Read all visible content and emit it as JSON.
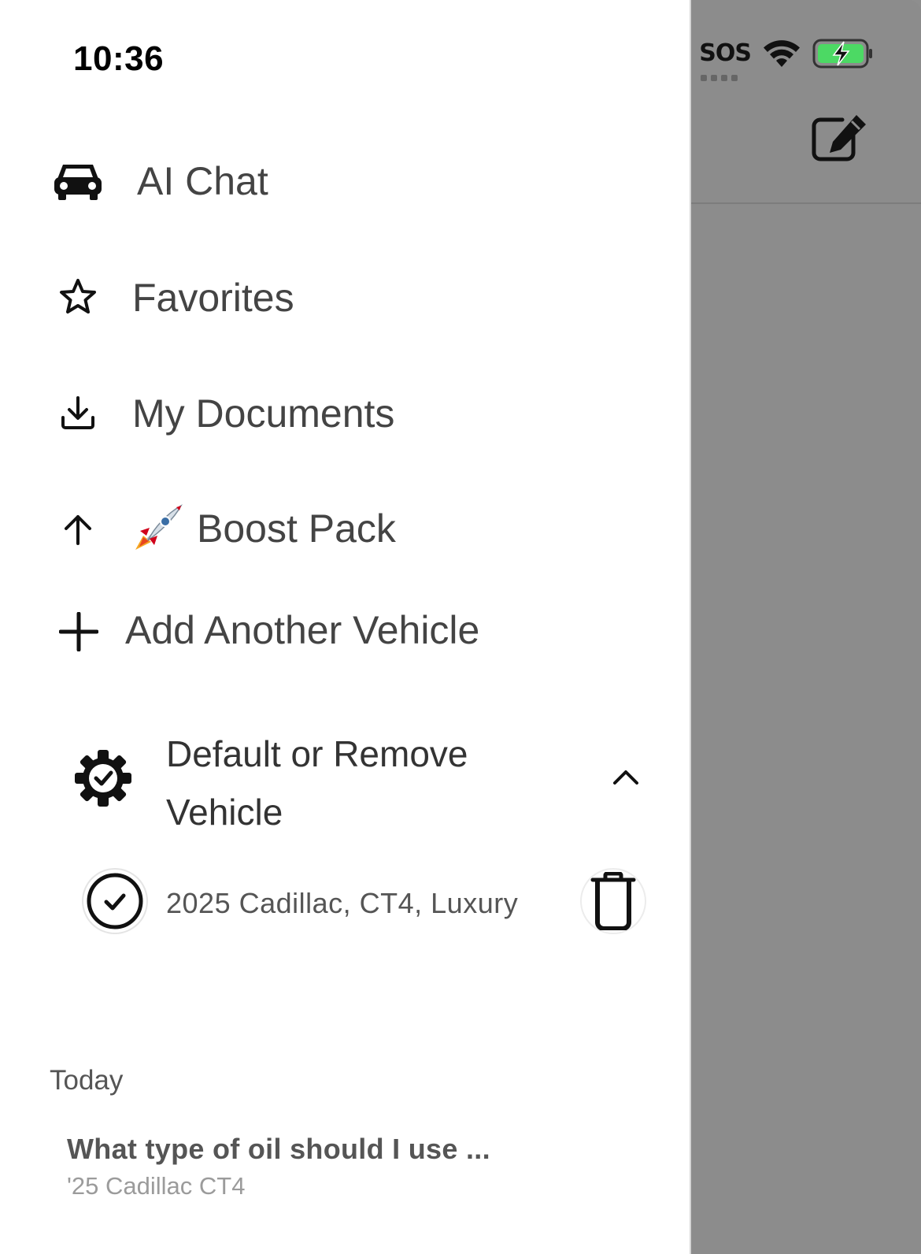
{
  "status_bar": {
    "time": "10:36",
    "carrier": "SOS"
  },
  "menu": {
    "items": [
      {
        "label": "AI Chat",
        "icon": "car-icon"
      },
      {
        "label": "Favorites",
        "icon": "star-icon"
      },
      {
        "label": "My Documents",
        "icon": "download-icon"
      },
      {
        "label": "Boost Pack",
        "icon": "arrow-up-icon",
        "emoji": "🚀"
      },
      {
        "label": "Add Another Vehicle",
        "icon": "plus-icon"
      }
    ]
  },
  "vehicles_section": {
    "title": "Default or Remove Vehicle",
    "vehicles": [
      {
        "label": "2025 Cadillac, CT4, Luxury"
      }
    ]
  },
  "history": {
    "group_label": "Today",
    "chats": [
      {
        "title": "What type of oil should I use ...",
        "subtitle": "'25 Cadillac CT4"
      }
    ]
  },
  "colors": {
    "battery_fill": "#4cd964",
    "overlay": "#8c8c8c"
  }
}
